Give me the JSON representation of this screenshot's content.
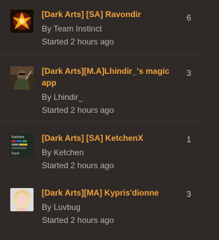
{
  "topics": [
    {
      "title": "[Dark Arts] [SA] Ravondir",
      "author_line": "By Team Instinct",
      "started": "Started 2 hours ago",
      "count": "6",
      "avatar_icon": "phoenix-crest-icon"
    },
    {
      "title": "[Dark Arts][M.A]Lhindir_'s magic app",
      "author_line": "By Lhindir_",
      "started": "Started 2 hours ago",
      "count": "3",
      "avatar_icon": "knight-portrait-icon"
    },
    {
      "title": "[Dark Arts] [SA] KetchenX",
      "author_line": "By Ketchen",
      "started": "Started 2 hours ago",
      "count": "1",
      "avatar_icon": "ketchen-stats-card-icon",
      "avatar_text": {
        "line1": "Ketchen",
        "line2": "Rank"
      }
    },
    {
      "title": "[Dark Arts][MA] Kypris'dionne",
      "author_line": "By Luvbug",
      "started": "Started 2 hours ago",
      "count": "3",
      "avatar_icon": "blonde-portrait-icon"
    }
  ],
  "colors": {
    "background": "#2f2a27",
    "title": "#f3a23c",
    "meta": "#b9b2ab"
  }
}
